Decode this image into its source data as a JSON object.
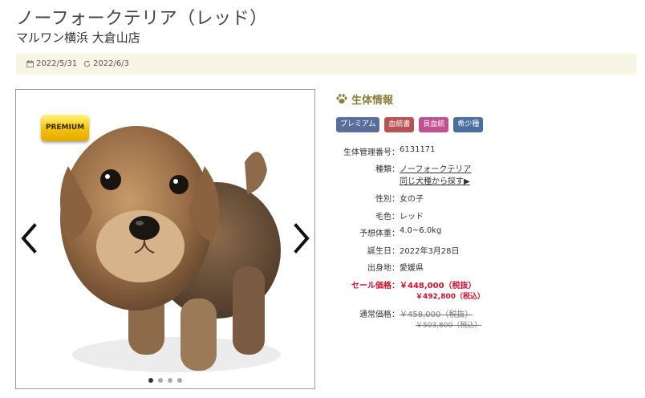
{
  "header": {
    "title": "ノーフォークテリア（レッド）",
    "shop": "マルワン横浜 大倉山店"
  },
  "dates": {
    "published": "2022/5/31",
    "updated": "2022/6/3"
  },
  "gallery": {
    "badge": "PREMIUM",
    "slide_count": 4,
    "active_slide": 1
  },
  "info": {
    "heading": "生体情報",
    "tags": [
      {
        "label": "プレミアム",
        "color": "#5a6e9c"
      },
      {
        "label": "血統書",
        "color": "#b85353"
      },
      {
        "label": "良血統",
        "color": "#c0508f"
      },
      {
        "label": "希少種",
        "color": "#4a6e9e"
      }
    ],
    "id_label": "生体管理番号：",
    "id_value": "6131171",
    "breed_label": "種類：",
    "breed_link": "ノーフォークテリア",
    "breed_search": "同じ犬種から探す▶",
    "sex_label": "性別：",
    "sex_value": "女の子",
    "color_label": "毛色：",
    "color_value": "レッド",
    "weight_label": "予想体重：",
    "weight_value": "4.0~6.0kg",
    "birth_label": "誕生日：",
    "birth_value": "2022年3月28日",
    "origin_label": "出身地：",
    "origin_value": "愛媛県",
    "sale_label": "セール価格：",
    "sale_price": "￥448,000（税抜）",
    "sale_price_tax": "￥492,800（税込）",
    "regular_label": "通常価格：",
    "regular_price": "￥458,000（税抜）",
    "regular_price_tax": "￥503,800（税込）"
  },
  "colors": {
    "accent": "#8a7d3c",
    "sale": "#d0112b",
    "datebar": "#f7f5e4"
  }
}
